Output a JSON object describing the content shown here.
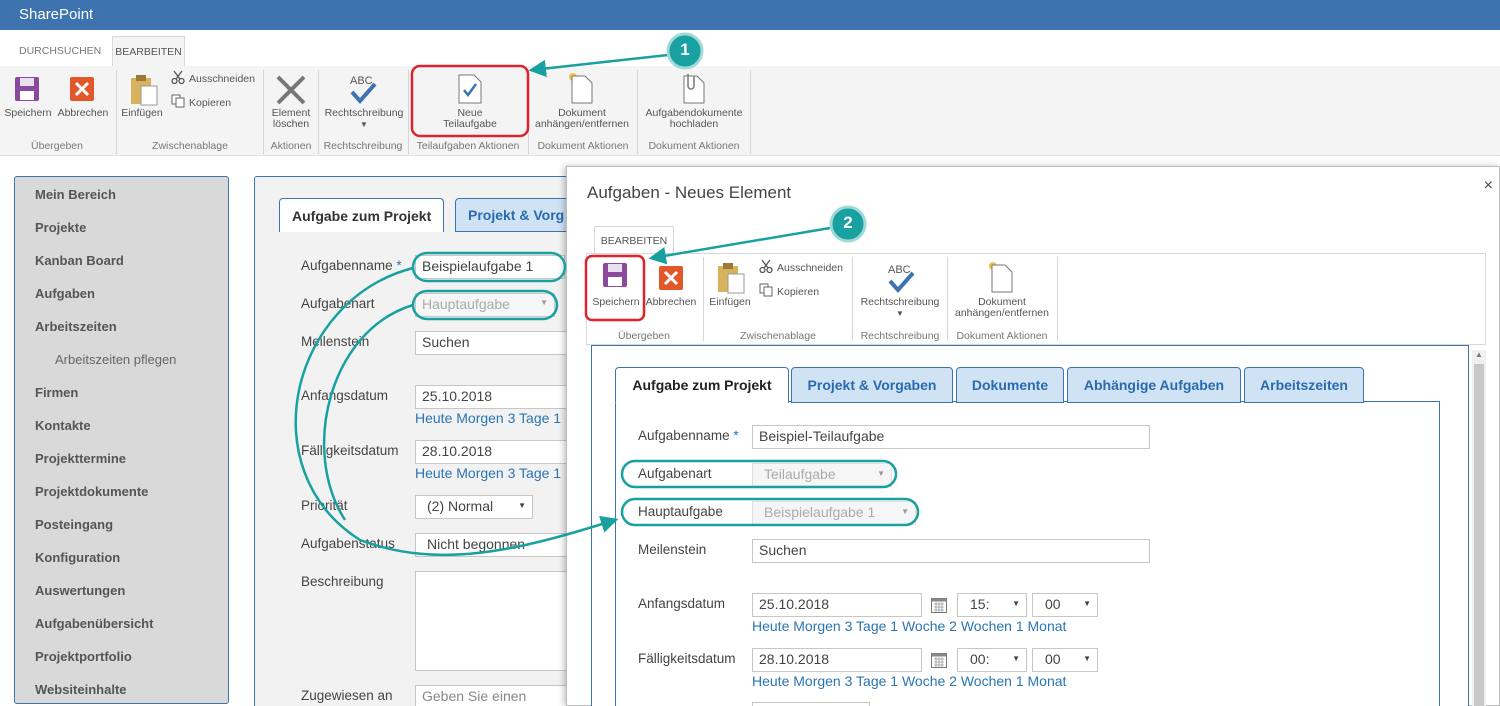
{
  "suite": {
    "brand": "SharePoint"
  },
  "ribbon_tabs": [
    "DURCHSUCHEN",
    "BEARBEITEN"
  ],
  "ribbon": {
    "save": "Speichern",
    "cancel": "Abbrechen",
    "paste": "Einfügen",
    "cut": "Ausschneiden",
    "copy": "Kopieren",
    "delete_1": "Element",
    "delete_2": "löschen",
    "spelling": "Rechtschreibung",
    "new_subtask_1": "Neue",
    "new_subtask_2": "Teilaufgabe",
    "attach_1": "Dokument",
    "attach_2": "anhängen/entfernen",
    "upload_1": "Aufgabendokumente",
    "upload_2": "hochladen",
    "groups": [
      "Übergeben",
      "Zwischenablage",
      "Aktionen",
      "Rechtschreibung",
      "Teilaufgaben Aktionen",
      "Dokument Aktionen",
      "Dokument Aktionen"
    ]
  },
  "callouts": [
    "1",
    "2"
  ],
  "nav": {
    "items": [
      "Mein Bereich",
      "Projekte",
      "Kanban Board",
      "Aufgaben",
      "Arbeitszeiten",
      "Arbeitszeiten pflegen",
      "Firmen",
      "Kontakte",
      "Projekttermine",
      "Projektdokumente",
      "Posteingang",
      "Konfiguration",
      "Auswertungen",
      "Aufgabenübersicht",
      "Projektportfolio",
      "Websiteinhalte"
    ]
  },
  "bg_form": {
    "tabs": [
      "Aufgabe zum Projekt",
      "Projekt & Vorg"
    ],
    "labels": {
      "name": "Aufgabenname",
      "required": "*",
      "type": "Aufgabenart",
      "milestone": "Meilenstein",
      "start": "Anfangsdatum",
      "due": "Fälligkeitsdatum",
      "priority": "Priorität",
      "status": "Aufgabenstatus",
      "description": "Beschreibung",
      "assigned": "Zugewiesen an"
    },
    "values": {
      "name": "Beispielaufgabe 1",
      "type": "Hauptaufgabe",
      "milestone": "Suchen",
      "start": "25.10.2018",
      "due": "28.10.2018",
      "priority": "(2) Normal",
      "status": "Nicht begonnen",
      "assigned": "Geben Sie einen Name"
    },
    "date_links": "Heute Morgen 3 Tage 1"
  },
  "dialog": {
    "title": "Aufgaben - Neues Element",
    "close": "×",
    "ribbon_tab": "BEARBEITEN",
    "ribbon": {
      "save": "Speichern",
      "cancel": "Abbrechen",
      "paste": "Einfügen",
      "cut": "Ausschneiden",
      "copy": "Kopieren",
      "spelling": "Rechtschreibung",
      "attach_1": "Dokument",
      "attach_2": "anhängen/entfernen",
      "groups": [
        "Übergeben",
        "Zwischenablage",
        "Rechtschreibung",
        "Dokument Aktionen"
      ]
    },
    "tabs": [
      "Aufgabe zum Projekt",
      "Projekt & Vorgaben",
      "Dokumente",
      "Abhängige Aufgaben",
      "Arbeitszeiten"
    ],
    "labels": {
      "name": "Aufgabenname",
      "required": "*",
      "type": "Aufgabenart",
      "parent": "Hauptaufgabe",
      "milestone": "Meilenstein",
      "start": "Anfangsdatum",
      "due": "Fälligkeitsdatum"
    },
    "values": {
      "name": "Beispiel-Teilaufgabe",
      "type": "Teilaufgabe",
      "parent": "Beispielaufgabe 1",
      "milestone": "Suchen",
      "start": "25.10.2018",
      "start_hour": "15:",
      "start_min": "00",
      "due": "28.10.2018",
      "due_hour": "00:",
      "due_min": "00"
    },
    "date_links": "Heute Morgen 3 Tage 1 Woche 2 Wochen 1 Monat"
  },
  "colors": {
    "accent": "#3d74b0",
    "callout": "#19a0a0",
    "highlight": "#d9252b",
    "link": "#2a75b5"
  }
}
